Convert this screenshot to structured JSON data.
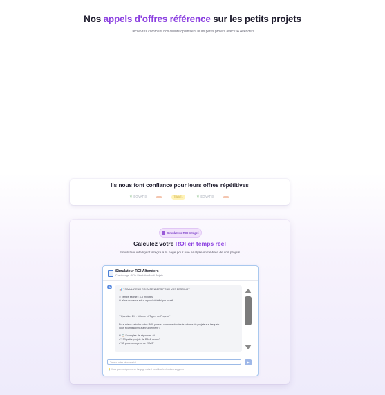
{
  "hero": {
    "title_part1": "Nos ",
    "title_accent": "appels d'offres référence",
    "title_part2": " sur les petits projets",
    "subtitle": "Découvrez comment nos clients optimisent leurs petits projets avec l'IA Altenders"
  },
  "trust": {
    "title": "Ils nous font confiance pour leurs offres répétitives",
    "logos": [
      "EGVATIS",
      "TRAVEL",
      "EGVATIS"
    ]
  },
  "roi": {
    "badge": "Simulateur ROI Intégré",
    "title_part1": "Calculez votre ",
    "title_accent": "ROI en temps réel",
    "subtitle": "Simulateur intelligent intégré à la page pour une analyse immédiate de vos projets"
  },
  "chat": {
    "title": "Simulateur ROI Altenders",
    "subtitle": "Cas d'usage : ATI • Simulation Multi-Projets",
    "avatar": "A",
    "messages": [
      "📊 **SIMULATEUR ROI ALTENDERS POUR VOS BESOINS**",
      "⏱ Temps estimé : 3-5 minutes",
      "✉ Vous recevrez votre rapport détaillé par email",
      "---",
      "**Question 1/4 : Volume et Types de Projets**",
      "Pour mieux calculer votre ROI, pouvez-vous me décrire le volume de projets sur lesquels",
      "vous soumissionnez annuellement ?",
      "** 📋 Exemples de réponses :**",
      "• \"150 petits projets de RAM, moins\"",
      "• \"80 projets moyens de 20M€\""
    ],
    "input_placeholder": "Tapez votre réponse ici...",
    "hint": "💡 Vous pouvez répondre en langage naturel ou utiliser les boutons suggérés"
  }
}
